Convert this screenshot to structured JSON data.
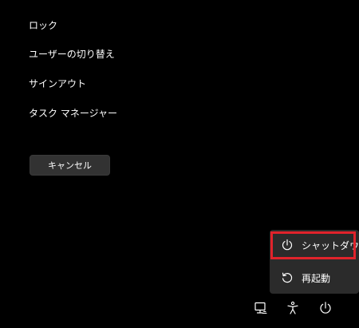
{
  "menu": {
    "items": [
      {
        "label": "ロック"
      },
      {
        "label": "ユーザーの切り替え"
      },
      {
        "label": "サインアウト"
      },
      {
        "label": "タスク マネージャー"
      }
    ]
  },
  "cancel": {
    "label": "キャンセル"
  },
  "power_menu": {
    "options": [
      {
        "label": "シャットダウン",
        "icon": "power-icon",
        "highlighted": true
      },
      {
        "label": "再起動",
        "icon": "restart-icon"
      }
    ],
    "highlight_color": "#e0232b"
  },
  "bottom_bar": {
    "icons": [
      "network-icon",
      "accessibility-icon",
      "power-icon"
    ]
  }
}
